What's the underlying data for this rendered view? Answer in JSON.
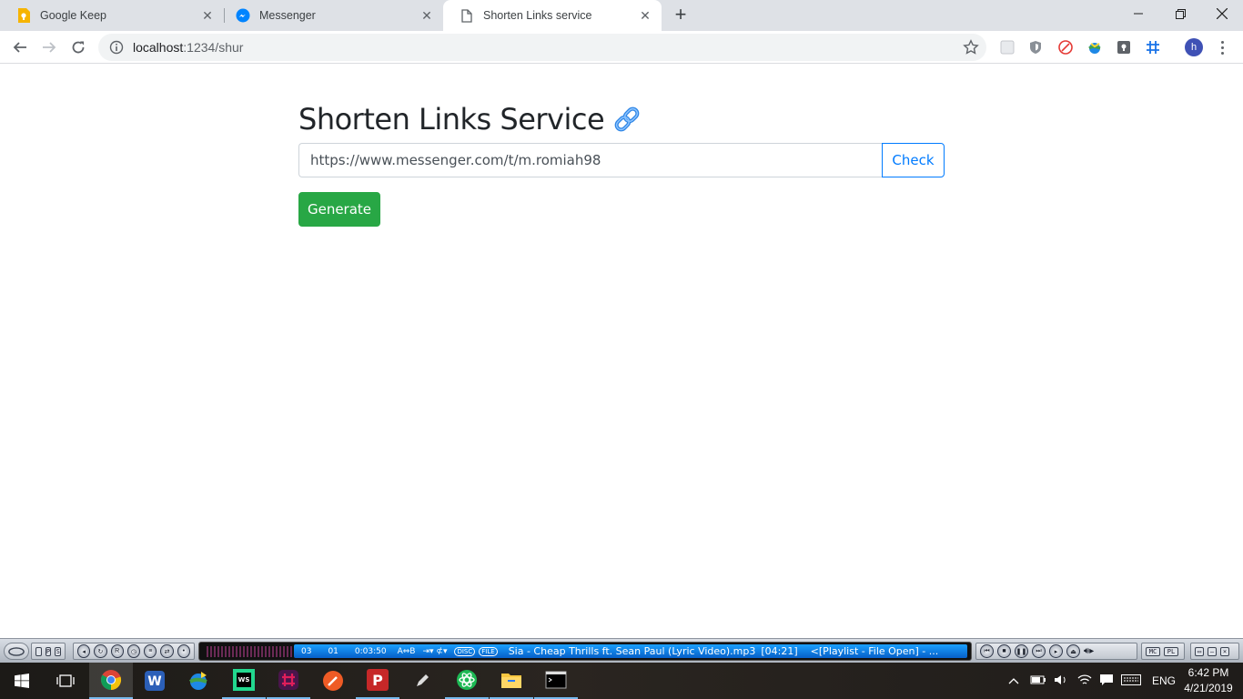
{
  "browser": {
    "tabs": [
      {
        "title": "Google Keep",
        "icon": "google-keep-icon"
      },
      {
        "title": "Messenger",
        "icon": "messenger-icon"
      },
      {
        "title": "Shorten Links service",
        "icon": "page-icon",
        "active": true
      }
    ],
    "address": {
      "host": "localhost",
      "rest": ":1234/shur"
    },
    "profile_initial": "h"
  },
  "page": {
    "heading": "Shorten Links Service",
    "heading_emoji": "link-icon",
    "url_value": "https://www.messenger.com/t/m.romiah98",
    "check_label": "Check",
    "generate_label": "Generate",
    "colors": {
      "primary": "#007bff",
      "success": "#28a745",
      "text": "#212529"
    }
  },
  "player": {
    "left_buttons": [
      "P",
      "S"
    ],
    "track_number": "03",
    "channel": "01",
    "elapsed": "0:03:50",
    "ab_label": "A⇔B",
    "disc_label": "DISC",
    "file_label": "FILE",
    "track_title": "Sia - Cheap Thrills ft. Sean Paul (Lyric Video).mp3",
    "track_length": "[04:21]",
    "playlist_status": "<[Playlist - File Open] - ...",
    "right_labels": [
      "MC",
      "PL"
    ]
  },
  "taskbar": {
    "apps": [
      "chrome-icon",
      "wps-writer-icon",
      "download-manager-icon",
      "webstorm-icon",
      "slack-icon",
      "postman-icon",
      "papers-icon",
      "pen-icon",
      "atom-icon",
      "file-explorer-icon",
      "terminal-icon"
    ],
    "language": "ENG",
    "time": "6:42 PM",
    "date": "4/21/2019"
  }
}
